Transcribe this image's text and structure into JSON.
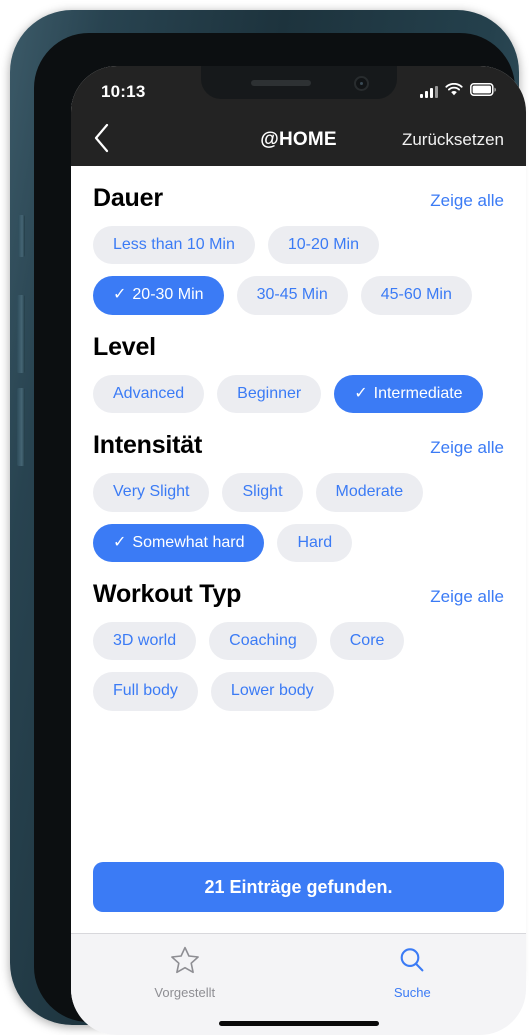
{
  "status_bar": {
    "time": "10:13",
    "signal_icon": "cellular-signal-icon",
    "wifi_icon": "wifi-icon",
    "battery_icon": "battery-full-icon"
  },
  "nav_bar": {
    "back_icon": "chevron-left-icon",
    "title": "@HOME",
    "reset_label": "Zurücksetzen"
  },
  "sections": [
    {
      "title": "Dauer",
      "link": "Zeige alle",
      "has_link": true,
      "chips": [
        {
          "label": "Less than 10 Min",
          "selected": false
        },
        {
          "label": "10-20 Min",
          "selected": false
        },
        {
          "label": "20-30 Min",
          "selected": true
        },
        {
          "label": "30-45 Min",
          "selected": false
        },
        {
          "label": "45-60 Min",
          "selected": false
        }
      ]
    },
    {
      "title": "Level",
      "link": "",
      "has_link": false,
      "chips": [
        {
          "label": "Advanced",
          "selected": false
        },
        {
          "label": "Beginner",
          "selected": false
        },
        {
          "label": "Intermediate",
          "selected": true
        }
      ]
    },
    {
      "title": "Intensität",
      "link": "Zeige alle",
      "has_link": true,
      "chips": [
        {
          "label": "Very Slight",
          "selected": false
        },
        {
          "label": "Slight",
          "selected": false
        },
        {
          "label": "Moderate",
          "selected": false
        },
        {
          "label": "Somewhat hard",
          "selected": true
        },
        {
          "label": "Hard",
          "selected": false
        }
      ]
    },
    {
      "title": "Workout Typ",
      "link": "Zeige alle",
      "has_link": true,
      "chips": [
        {
          "label": "3D world",
          "selected": false
        },
        {
          "label": "Coaching",
          "selected": false
        },
        {
          "label": "Core",
          "selected": false
        },
        {
          "label": "Full body",
          "selected": false
        },
        {
          "label": "Lower body",
          "selected": false
        }
      ]
    }
  ],
  "results_button": {
    "label": "21 Einträge gefunden."
  },
  "tab_bar": {
    "tabs": [
      {
        "label": "Vorgestellt",
        "icon": "star-icon",
        "active": false
      },
      {
        "label": "Suche",
        "icon": "search-icon",
        "active": true
      }
    ]
  },
  "selection_mark": "✓",
  "colors": {
    "accent": "#3b7bf5",
    "chip_background": "#ecedf1",
    "nav_background": "#232323",
    "tab_background": "#f4f4f6",
    "inactive_tab": "#8e8e93"
  }
}
